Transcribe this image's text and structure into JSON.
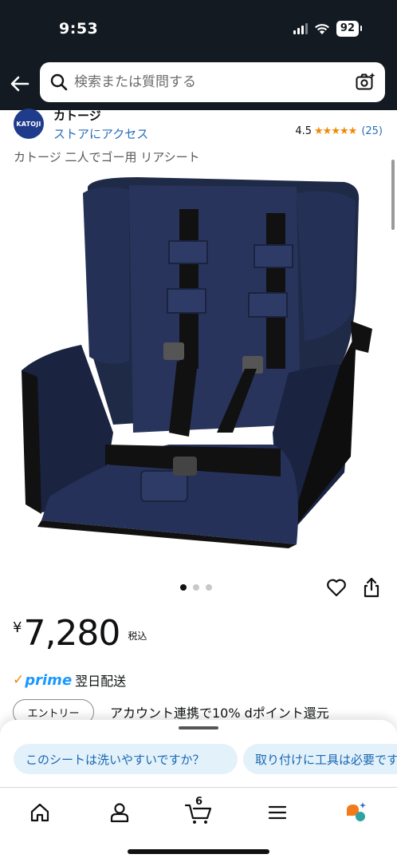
{
  "status_bar": {
    "time": "9:53",
    "battery": "92"
  },
  "header": {
    "search_placeholder": "検索または質問する"
  },
  "brand": {
    "logo_text": "KATOJI",
    "name": "カトージ",
    "store_link": "ストアにアクセス"
  },
  "rating": {
    "value": "4.5",
    "stars": "★★★★★",
    "count": "(25)",
    "stars_value": 4.5
  },
  "product": {
    "title": "カトージ 二人でゴー用 リアシート"
  },
  "image_carousel": {
    "total": 3,
    "active": 1
  },
  "price": {
    "currency": "¥",
    "amount": "7,280",
    "tax_label": "税込"
  },
  "delivery": {
    "check": "✓",
    "prime": "prime",
    "text": "翌日配送"
  },
  "promo": {
    "entry_label": "エントリー",
    "text": "アカウント連携で10% dポイント還元"
  },
  "suggestions": [
    {
      "label": "このシートは洗いやすいですか？"
    },
    {
      "label": "取り付けに工具は必要ですか"
    }
  ],
  "bottom_nav": {
    "cart_count": "6"
  },
  "colors": {
    "header_bg": "#131a22",
    "link": "#2a6ebb",
    "star": "#f08804",
    "chip_bg": "#e3f1fb",
    "prime": "#1a98ff"
  }
}
